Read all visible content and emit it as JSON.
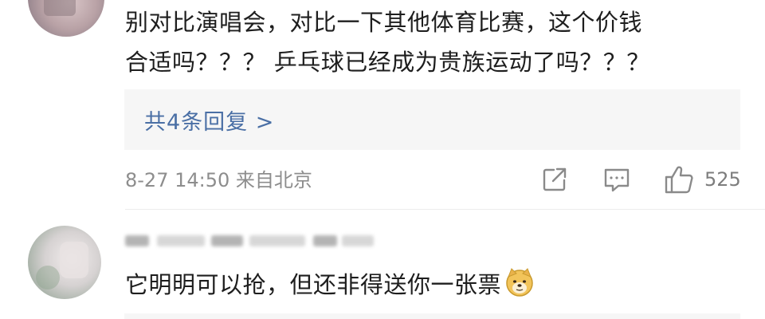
{
  "comment1": {
    "line1": "别对比演唱会，对比一下其他体育比赛，这个价钱",
    "line2": "合适吗？？？ 乒乓球已经成为贵族运动了吗？？？",
    "replies_link": "共4条回复 >",
    "meta": "8-27 14:50 来自北京",
    "like_count": "525"
  },
  "comment2": {
    "text": "它明明可以抢，但还非得送你一张票",
    "emoji": "doge-emoji"
  },
  "icons": {
    "share": "share-icon",
    "reply": "comment-icon",
    "like": "thumbs-up-icon"
  },
  "colors": {
    "link": "#4a6fa5",
    "meta": "#8d8d8d",
    "reply_bg": "#f6f6f6"
  }
}
